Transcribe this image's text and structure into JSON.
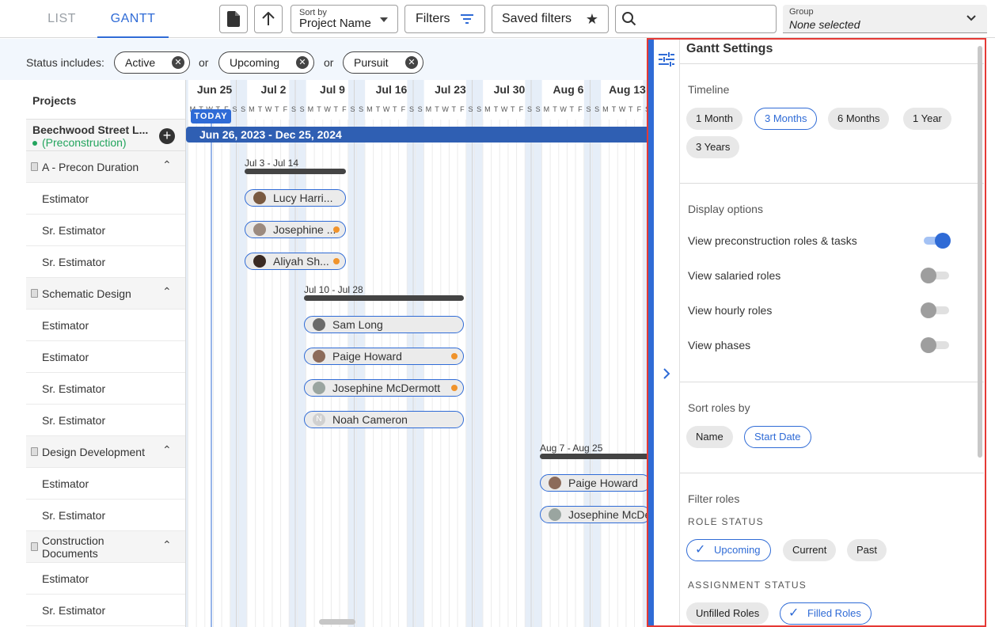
{
  "tabs": [
    {
      "label": "LIST"
    },
    {
      "label": "GANTT"
    }
  ],
  "toolbar": {
    "sort_caption": "Sort by",
    "sort_value": "Project Name",
    "filters_label": "Filters",
    "saved_filters_label": "Saved filters",
    "search_placeholder": "",
    "group_caption": "Group",
    "group_value": "None selected"
  },
  "status": {
    "label": "Status includes:",
    "chips": [
      "Active",
      "Upcoming",
      "Pursuit"
    ],
    "or": "or"
  },
  "left": {
    "header": "Projects",
    "project_name": "Beechwood Street L...",
    "project_status": "(Preconstruction)",
    "rows": [
      {
        "label": "A - Precon Duration",
        "phase": true
      },
      {
        "label": "Estimator"
      },
      {
        "label": "Sr. Estimator"
      },
      {
        "label": "Sr. Estimator"
      },
      {
        "label": "Schematic Design",
        "phase": true
      },
      {
        "label": "Estimator"
      },
      {
        "label": "Estimator"
      },
      {
        "label": "Sr. Estimator"
      },
      {
        "label": "Sr. Estimator"
      },
      {
        "label": "Design Development",
        "phase": true
      },
      {
        "label": "Estimator"
      },
      {
        "label": "Sr. Estimator"
      },
      {
        "label": "Construction\nDocuments",
        "phase": true
      },
      {
        "label": "Estimator"
      },
      {
        "label": "Sr. Estimator"
      }
    ]
  },
  "gantt": {
    "weeks": [
      "Jun 25",
      "Jul 2",
      "Jul 9",
      "Jul 16",
      "Jul 23",
      "Jul 30",
      "Aug 6",
      "Aug 13"
    ],
    "day_letters": [
      "S",
      "M",
      "T",
      "W",
      "T",
      "F",
      "S"
    ],
    "today_label": "TODAY",
    "project_range": "Jun 26, 2023 - Dec 25, 2024",
    "phase_ranges": [
      "Jul 3 - Jul 14",
      "Jul 10 - Jul 28",
      "Aug 7 - Aug 25"
    ],
    "assignments": [
      {
        "name": "Lucy Harri...",
        "dot": false
      },
      {
        "name": "Josephine ...",
        "dot": true
      },
      {
        "name": "Aliyah Sh...",
        "dot": true
      },
      {
        "name": "Sam Long",
        "dot": false
      },
      {
        "name": "Paige Howard",
        "dot": true
      },
      {
        "name": "Josephine McDermott",
        "dot": true
      },
      {
        "name": "Noah Cameron",
        "dot": false,
        "initial": "N"
      },
      {
        "name": "Paige Howard",
        "dot": false
      },
      {
        "name": "Josephine McDe",
        "dot": false
      }
    ]
  },
  "panel": {
    "title": "Gantt Settings",
    "timeline": {
      "label": "Timeline",
      "options": [
        "1 Month",
        "3 Months",
        "6 Months",
        "1 Year",
        "3 Years"
      ],
      "selected": "3 Months"
    },
    "display": {
      "label": "Display options",
      "toggles": [
        {
          "label": "View preconstruction roles & tasks",
          "on": true
        },
        {
          "label": "View salaried roles",
          "on": false
        },
        {
          "label": "View hourly roles",
          "on": false
        },
        {
          "label": "View phases",
          "on": false
        }
      ]
    },
    "sort": {
      "label": "Sort roles by",
      "options": [
        "Name",
        "Start Date"
      ],
      "selected": "Start Date"
    },
    "filter": {
      "label": "Filter roles",
      "role_status_label": "ROLE STATUS",
      "role_status": [
        "Upcoming",
        "Current",
        "Past"
      ],
      "role_status_selected": "Upcoming",
      "assignment_status_label": "ASSIGNMENT STATUS",
      "assignment_status": [
        "Unfilled Roles",
        "Filled Roles"
      ],
      "assignment_selected": "Filled Roles"
    }
  },
  "colors": {
    "accent": "#2f6bd6",
    "project_bar": "#2f5fb3",
    "panel_border": "#e53935",
    "status_green": "#22a45d",
    "dot": "#f0932b"
  }
}
